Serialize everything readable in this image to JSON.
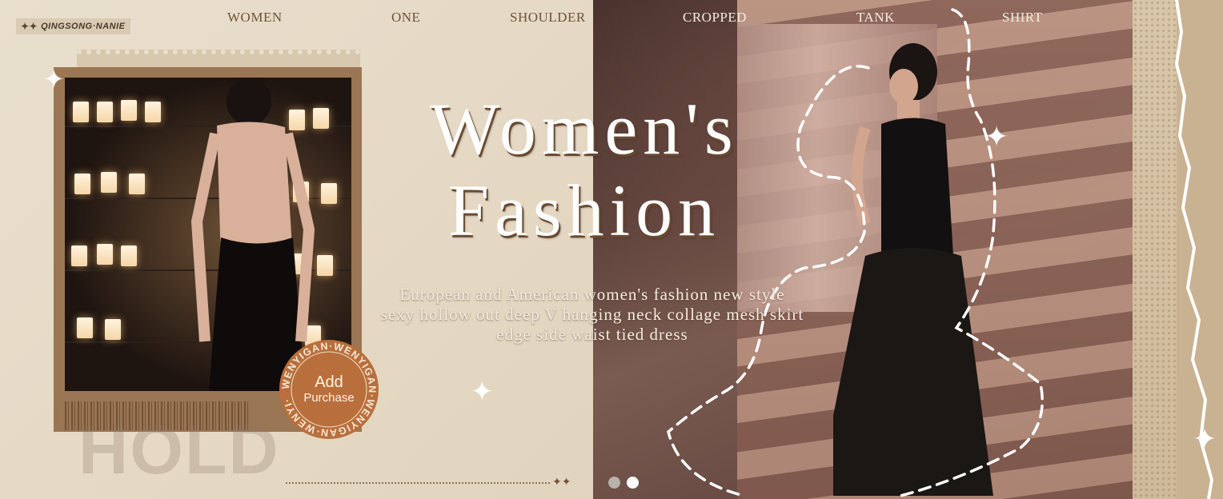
{
  "brand": {
    "name": "QINGSONG·NANIE",
    "icon": "four-point-star-icon"
  },
  "nav": [
    {
      "label": "WOMEN"
    },
    {
      "label": "ONE"
    },
    {
      "label": "SHOULDER"
    },
    {
      "label": "CROPPED"
    },
    {
      "label": "TANK"
    },
    {
      "label": "SHIRT"
    }
  ],
  "hero": {
    "title_line1": "Women's",
    "title_line2": "Fashion",
    "subtitle_line1": "European and American women's fashion new style",
    "subtitle_line2": "sexy hollow out deep V hanging neck collage mesh skirt",
    "subtitle_line3": "edge side waist tied dress"
  },
  "cta": {
    "line1": "Add",
    "line2": "Purchase",
    "ring_text": "WENYIGAN·WENYIGAN·WENYIGAN·WENYI·"
  },
  "decor": {
    "watermark": "HOLD"
  },
  "carousel": {
    "count": 2,
    "active": 2
  },
  "colors": {
    "accent": "#b96f3c",
    "nav_dark": "#6e5337",
    "background": "#e5d9c4"
  }
}
